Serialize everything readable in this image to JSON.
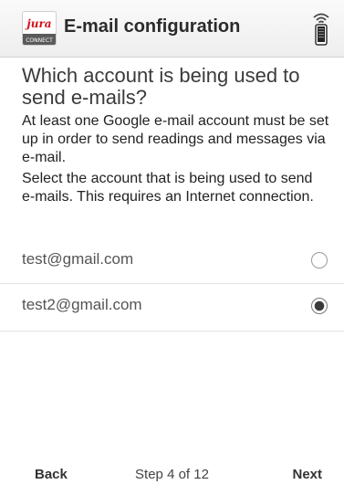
{
  "header": {
    "logo_icon": "jura-connect-logo",
    "logo_brand": "jura",
    "logo_sub": "CONNECT",
    "title": "E-mail configuration",
    "device_icon": "wireless-device-icon"
  },
  "main": {
    "question": "Which account is being used to send e-mails?",
    "paragraphs": [
      "At least one Google e-mail account must be set up in order to send readings and messages via e-mail.",
      "Select the account that is being used to send e-mails. This requires an Internet connection."
    ],
    "accounts": [
      {
        "email": "test@gmail.com",
        "selected": false
      },
      {
        "email": "test2@gmail.com",
        "selected": true
      }
    ]
  },
  "footer": {
    "back_label": "Back",
    "step_text": "Step 4 of 12",
    "next_label": "Next"
  },
  "colors": {
    "accent_red": "#d0121b",
    "header_bg": "#f2f2f2",
    "divider": "#e2e2e2"
  }
}
